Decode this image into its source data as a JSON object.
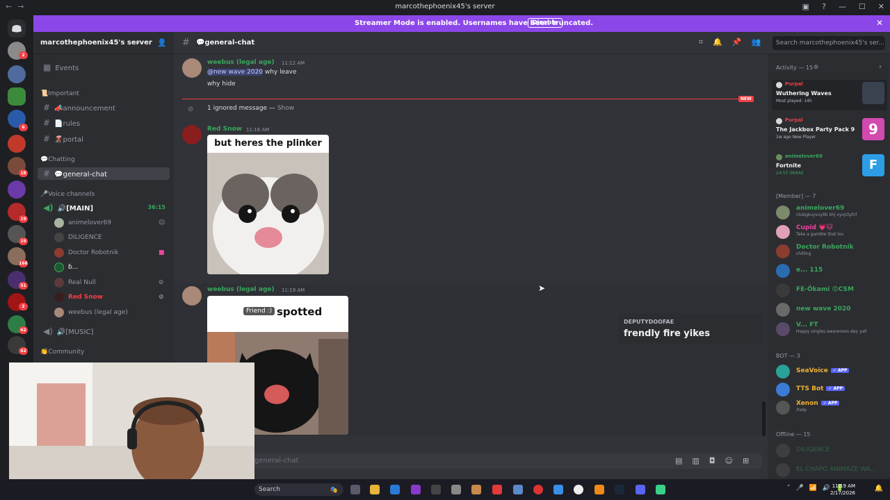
{
  "window": {
    "title": "marcothephoenix45's server"
  },
  "banner": {
    "text": "Streamer Mode is enabled. Usernames have been truncated.",
    "button": "Disable"
  },
  "server": {
    "name": "marcothephoenix45's server"
  },
  "sidebar": {
    "events": "Events",
    "cat_important": "📜Important",
    "announcement": "📣announcement",
    "rules": "📄rules",
    "portal": "🌋portal",
    "cat_chatting": "💬Chatting",
    "general": "💬general-chat",
    "cat_voice": "🎤Voice channels",
    "main_voice": "🔊[MAIN]",
    "main_timer": "36:15",
    "voice_users": [
      "animelover69",
      "DILIGENCE",
      "Doctor Robotnik",
      "ɓ...",
      "Real Null",
      "Red Snow",
      "weebus (legal age)"
    ],
    "music_voice": "🔊[MUSIC]",
    "cat_community": "👏Community"
  },
  "header": {
    "channel": "💬general-chat",
    "search_placeholder": "Search marcothephoenix45's ser..."
  },
  "chat": {
    "m1_user": "weebus (legal age)",
    "m1_time": "11:12 AM",
    "m1_mention": "@new wave 2020",
    "m1_text": " why leave",
    "m1_text2": "why hide",
    "new_label": "NEW",
    "ignored": "1 ignored message —",
    "ignored_show": "Show",
    "m2_user": "Red Snow",
    "m2_time": "11:16 AM",
    "m2_caption": "but heres the plinker",
    "m3_user": "weebus (legal age)",
    "m3_time": "11:19 AM",
    "m3_caption": "spotted",
    "m3_tag": "Friend :)",
    "tooltip_title": "DEPUTYDOOFAE",
    "tooltip_text": "frendly fire yikes",
    "input_placeholder": "general-chat"
  },
  "members": {
    "activity_header": "Activity — 15",
    "activities": [
      {
        "who": "Purpal",
        "game": "Wuthering Waves",
        "sub": "Most played: 14h"
      },
      {
        "who": "Purpal",
        "game": "The Jackbox Party Pack 9",
        "sub": "1w ago  New Player"
      },
      {
        "who": "animelover69",
        "game": "Fortnite",
        "sub": "24:55  [MAIN]"
      }
    ],
    "member_header": "[Member] — 7",
    "list": [
      {
        "name": "animelover69",
        "status": "nlubgkuyvuyllb khj vyvjctyfcf",
        "color": "#3ba55d"
      },
      {
        "name": "Cupid 💗🐱",
        "status": "Take a gamble that lov",
        "color": "#eb459e"
      },
      {
        "name": "Doctor Robotnik",
        "status": "chilling",
        "color": "#3ba55d"
      },
      {
        "name": "e... 115",
        "status": "",
        "color": "#3ba55d"
      },
      {
        "name": "FE-Ōkami 😡CSM",
        "status": "",
        "color": "#3ba55d"
      },
      {
        "name": "new wave 2020",
        "status": "",
        "color": "#3ba55d"
      },
      {
        "name": "V... FT",
        "status": "Happy singles awareness day yall",
        "color": "#3ba55d"
      }
    ],
    "bot_header": "BOT — 3",
    "bots": [
      {
        "name": "SeaVoice",
        "tag": "✓ APP",
        "status": "",
        "color": "#f0b232"
      },
      {
        "name": "TTS Bot",
        "tag": "✓ APP",
        "status": "",
        "color": "#f0b232"
      },
      {
        "name": "Xenon",
        "tag": "✓ APP",
        "status": "/help",
        "color": "#f0b232"
      }
    ],
    "offline_header": "Offline — 15",
    "offline": [
      "DILIGENCE",
      "EL CHAPO ANIMAZE WA..."
    ]
  },
  "taskbar": {
    "search": "Search",
    "time": "11:19 AM",
    "date": "2/17/2026"
  },
  "colors": {
    "accent": "#8c47e8",
    "blurple": "#5865f2",
    "green": "#3ba55d",
    "red": "#f23f43"
  }
}
